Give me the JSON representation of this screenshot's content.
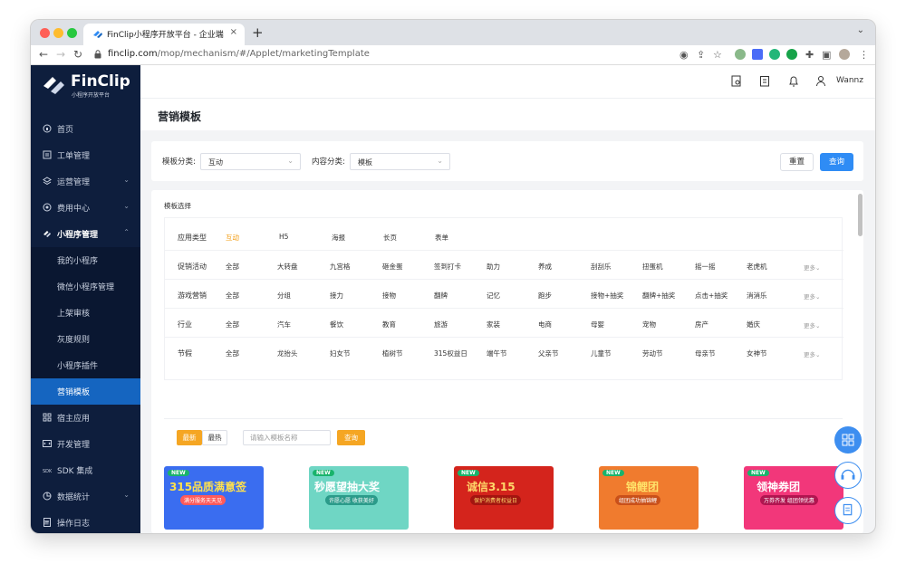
{
  "browser": {
    "tab_title": "FinClip小程序开放平台 - 企业端",
    "url_host": "finclip.com",
    "url_path": "/mop/mechanism/#/Applet/marketingTemplate",
    "new_tab": "+",
    "close": "×"
  },
  "brand": {
    "name": "FinClip",
    "subtitle": "小程序开放平台"
  },
  "sidebar": {
    "items": [
      {
        "label": "首页",
        "icon": "home-icon"
      },
      {
        "label": "工单管理",
        "icon": "ticket-icon"
      },
      {
        "label": "运营管理",
        "icon": "layers-icon"
      },
      {
        "label": "费用中心",
        "icon": "money-icon"
      },
      {
        "label": "小程序管理",
        "icon": "miniprogram-icon"
      }
    ],
    "subitems": [
      "我的小程序",
      "微信小程序管理",
      "上架审核",
      "灰度规则",
      "小程序插件",
      "营销模板"
    ],
    "bottom_items": [
      {
        "label": "宿主应用",
        "icon": "grid-icon"
      },
      {
        "label": "开发管理",
        "icon": "code-icon"
      },
      {
        "label": "SDK 集成",
        "icon": "sdk-icon"
      },
      {
        "label": "数据统计",
        "icon": "chart-icon"
      },
      {
        "label": "操作日志",
        "icon": "log-icon"
      }
    ],
    "collapse_icon": "≡"
  },
  "header": {
    "username": "Wannz",
    "icons": [
      "doc-search-icon",
      "clipboard-icon",
      "bell-icon",
      "user-icon"
    ]
  },
  "page": {
    "title": "营销模板"
  },
  "filter": {
    "category_label": "模板分类:",
    "category_value": "互动",
    "content_label": "内容分类:",
    "content_value": "模板",
    "reset": "重置",
    "query": "查询"
  },
  "templates": {
    "section_title": "模板选择",
    "rows": [
      {
        "label": "应用类型",
        "items": [
          "互动",
          "H5",
          "海报",
          "长页",
          "表单"
        ],
        "more": ""
      },
      {
        "label": "促销活动",
        "items": [
          "全部",
          "大转盘",
          "九宫格",
          "砸金蛋",
          "签到打卡",
          "助力",
          "养成",
          "刮刮乐",
          "扭蛋机",
          "摇一摇",
          "老虎机"
        ],
        "more": "更多⌄"
      },
      {
        "label": "游戏营销",
        "items": [
          "全部",
          "分组",
          "接力",
          "接物",
          "翻牌",
          "记忆",
          "跑步",
          "接物+抽奖",
          "翻牌+抽奖",
          "点击+抽奖",
          "消消乐"
        ],
        "more": "更多⌄"
      },
      {
        "label": "行业",
        "items": [
          "全部",
          "汽车",
          "餐饮",
          "教育",
          "旅游",
          "家装",
          "电商",
          "母婴",
          "宠物",
          "房产",
          "婚庆"
        ],
        "more": "更多⌄"
      },
      {
        "label": "节假",
        "items": [
          "全部",
          "龙抬头",
          "妇女节",
          "植树节",
          "315权益日",
          "端午节",
          "父亲节",
          "儿童节",
          "劳动节",
          "母亲节",
          "女神节"
        ],
        "more": "更多⌄"
      }
    ],
    "sort_new": "最新",
    "sort_hot": "最热",
    "search_placeholder": "请输入模板名称",
    "search_button": "查询",
    "cards": [
      {
        "badge": "NEW",
        "caption": "315品质满意签",
        "sub": "满分服务天天见",
        "bg": "#3a6df0",
        "fg": "#ffe14d"
      },
      {
        "badge": "NEW",
        "caption": "秒愿望抽大奖",
        "sub": "许愿心愿 收获美好",
        "bg": "#6fd6c4",
        "fg": "#ffffff"
      },
      {
        "badge": "NEW",
        "caption": "诚信3.15",
        "sub": "保护消费者权益日",
        "bg": "#d4241c",
        "fg": "#ffd76a"
      },
      {
        "badge": "NEW",
        "caption": "锦鲤团",
        "sub": "组团成功抽锦鲤",
        "bg": "#f07b2e",
        "fg": "#ffe36a"
      },
      {
        "badge": "NEW",
        "caption": "领神券团",
        "sub": "万券齐发 组团领优惠",
        "bg": "#f2377a",
        "fg": "#ffffff"
      }
    ]
  },
  "colors": {
    "sidebar_bg": "#0e1e3d",
    "active_blue": "#1565c0",
    "primary": "#2f8cf5",
    "accent_orange": "#f5a623"
  }
}
